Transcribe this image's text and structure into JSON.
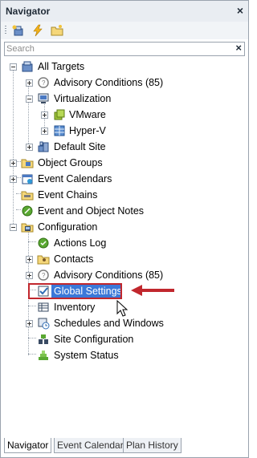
{
  "header": {
    "title": "Navigator",
    "close_icon": "×"
  },
  "toolbar": {
    "buttons": [
      {
        "name": "new-target-icon"
      },
      {
        "name": "lightning-icon"
      },
      {
        "name": "folder-icon"
      }
    ]
  },
  "search": {
    "placeholder": "Search",
    "value": "",
    "clear_icon": "×"
  },
  "tree": {
    "all_targets": "All Targets",
    "advisory_conditions": "Advisory Conditions (85)",
    "virtualization": "Virtualization",
    "vmware": "VMware",
    "hyperv": "Hyper-V",
    "default_site": "Default Site",
    "object_groups": "Object Groups",
    "event_calendars": "Event Calendars",
    "event_chains": "Event Chains",
    "event_object_notes": "Event and Object Notes",
    "configuration": "Configuration",
    "actions_log": "Actions Log",
    "contacts": "Contacts",
    "config_advisory_conditions": "Advisory Conditions (85)",
    "global_settings": "Global Settings",
    "inventory": "Inventory",
    "schedules_windows": "Schedules and Windows",
    "site_configuration": "Site Configuration",
    "system_status": "System Status"
  },
  "tabs": [
    "Navigator",
    "Event Calendar",
    "Plan History"
  ],
  "colors": {
    "selection": "#3b78d8",
    "highlight": "#c1272d",
    "accent": "#2f6db5"
  }
}
